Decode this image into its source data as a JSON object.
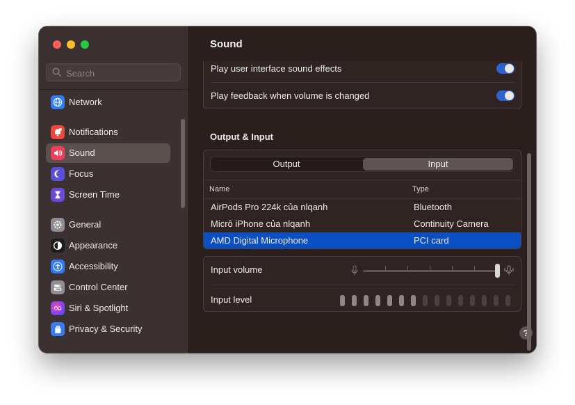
{
  "sidebar": {
    "search_placeholder": "Search",
    "items": [
      {
        "label": "Network",
        "icon": "network-globe-icon",
        "color": "#2e7cf6"
      },
      {
        "label": "Notifications",
        "icon": "notification-bell-icon",
        "color": "#f0453a"
      },
      {
        "label": "Sound",
        "icon": "speaker-icon",
        "color": "#f03d5a",
        "selected": true
      },
      {
        "label": "Focus",
        "icon": "moon-icon",
        "color": "#5b4fd9"
      },
      {
        "label": "Screen Time",
        "icon": "hourglass-icon",
        "color": "#6a4ad6"
      },
      {
        "label": "General",
        "icon": "gear-icon",
        "color": "#8e8e93"
      },
      {
        "label": "Appearance",
        "icon": "appearance-icon",
        "color": "#1c1c1e"
      },
      {
        "label": "Accessibility",
        "icon": "accessibility-icon",
        "color": "#2e7cf6"
      },
      {
        "label": "Control Center",
        "icon": "control-center-icon",
        "color": "#8e8e93"
      },
      {
        "label": "Siri & Spotlight",
        "icon": "siri-icon",
        "color": "#b03fd6"
      },
      {
        "label": "Privacy & Security",
        "icon": "hand-icon",
        "color": "#3a7cf0"
      }
    ]
  },
  "main": {
    "title": "Sound",
    "settings": [
      {
        "label": "Play user interface sound effects",
        "enabled": true
      },
      {
        "label": "Play feedback when volume is changed",
        "enabled": true
      }
    ],
    "output_input": {
      "heading": "Output & Input",
      "tabs": [
        {
          "label": "Output",
          "selected": false
        },
        {
          "label": "Input",
          "selected": true
        }
      ],
      "columns": {
        "name": "Name",
        "type": "Type"
      },
      "devices": [
        {
          "name": "AirPods Pro 224k của nlqanh",
          "type": "Bluetooth",
          "selected": false
        },
        {
          "name": "Micrô iPhone của nlqanh",
          "type": "Continuity Camera",
          "selected": false
        },
        {
          "name": "AMD Digital Microphone",
          "type": "PCI card",
          "selected": true
        }
      ]
    },
    "input_volume": {
      "label": "Input volume",
      "value": 1.0
    },
    "input_level": {
      "label": "Input level",
      "total_bars": 15,
      "lit_bars": 7
    },
    "help_label": "?"
  },
  "colors": {
    "accent": "#2e62d0",
    "selection": "#0b4fc3"
  }
}
